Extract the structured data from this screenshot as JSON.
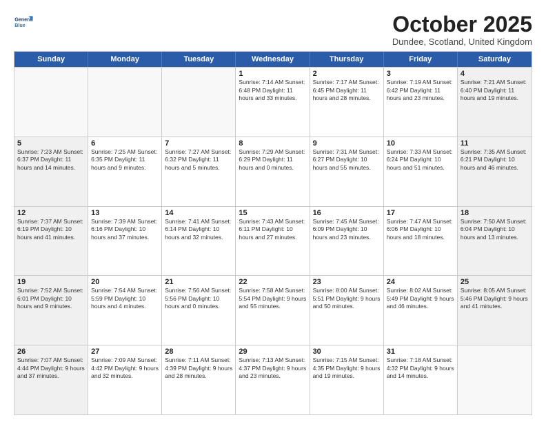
{
  "header": {
    "logo_line1": "General",
    "logo_line2": "Blue",
    "month": "October 2025",
    "location": "Dundee, Scotland, United Kingdom"
  },
  "weekdays": [
    "Sunday",
    "Monday",
    "Tuesday",
    "Wednesday",
    "Thursday",
    "Friday",
    "Saturday"
  ],
  "rows": [
    [
      {
        "day": "",
        "text": "",
        "empty": true
      },
      {
        "day": "",
        "text": "",
        "empty": true
      },
      {
        "day": "",
        "text": "",
        "empty": true
      },
      {
        "day": "1",
        "text": "Sunrise: 7:14 AM\nSunset: 6:48 PM\nDaylight: 11 hours\nand 33 minutes."
      },
      {
        "day": "2",
        "text": "Sunrise: 7:17 AM\nSunset: 6:45 PM\nDaylight: 11 hours\nand 28 minutes."
      },
      {
        "day": "3",
        "text": "Sunrise: 7:19 AM\nSunset: 6:42 PM\nDaylight: 11 hours\nand 23 minutes."
      },
      {
        "day": "4",
        "text": "Sunrise: 7:21 AM\nSunset: 6:40 PM\nDaylight: 11 hours\nand 19 minutes.",
        "shaded": true
      }
    ],
    [
      {
        "day": "5",
        "text": "Sunrise: 7:23 AM\nSunset: 6:37 PM\nDaylight: 11 hours\nand 14 minutes.",
        "shaded": true
      },
      {
        "day": "6",
        "text": "Sunrise: 7:25 AM\nSunset: 6:35 PM\nDaylight: 11 hours\nand 9 minutes."
      },
      {
        "day": "7",
        "text": "Sunrise: 7:27 AM\nSunset: 6:32 PM\nDaylight: 11 hours\nand 5 minutes."
      },
      {
        "day": "8",
        "text": "Sunrise: 7:29 AM\nSunset: 6:29 PM\nDaylight: 11 hours\nand 0 minutes."
      },
      {
        "day": "9",
        "text": "Sunrise: 7:31 AM\nSunset: 6:27 PM\nDaylight: 10 hours\nand 55 minutes."
      },
      {
        "day": "10",
        "text": "Sunrise: 7:33 AM\nSunset: 6:24 PM\nDaylight: 10 hours\nand 51 minutes."
      },
      {
        "day": "11",
        "text": "Sunrise: 7:35 AM\nSunset: 6:21 PM\nDaylight: 10 hours\nand 46 minutes.",
        "shaded": true
      }
    ],
    [
      {
        "day": "12",
        "text": "Sunrise: 7:37 AM\nSunset: 6:19 PM\nDaylight: 10 hours\nand 41 minutes.",
        "shaded": true
      },
      {
        "day": "13",
        "text": "Sunrise: 7:39 AM\nSunset: 6:16 PM\nDaylight: 10 hours\nand 37 minutes."
      },
      {
        "day": "14",
        "text": "Sunrise: 7:41 AM\nSunset: 6:14 PM\nDaylight: 10 hours\nand 32 minutes."
      },
      {
        "day": "15",
        "text": "Sunrise: 7:43 AM\nSunset: 6:11 PM\nDaylight: 10 hours\nand 27 minutes."
      },
      {
        "day": "16",
        "text": "Sunrise: 7:45 AM\nSunset: 6:09 PM\nDaylight: 10 hours\nand 23 minutes."
      },
      {
        "day": "17",
        "text": "Sunrise: 7:47 AM\nSunset: 6:06 PM\nDaylight: 10 hours\nand 18 minutes."
      },
      {
        "day": "18",
        "text": "Sunrise: 7:50 AM\nSunset: 6:04 PM\nDaylight: 10 hours\nand 13 minutes.",
        "shaded": true
      }
    ],
    [
      {
        "day": "19",
        "text": "Sunrise: 7:52 AM\nSunset: 6:01 PM\nDaylight: 10 hours\nand 9 minutes.",
        "shaded": true
      },
      {
        "day": "20",
        "text": "Sunrise: 7:54 AM\nSunset: 5:59 PM\nDaylight: 10 hours\nand 4 minutes."
      },
      {
        "day": "21",
        "text": "Sunrise: 7:56 AM\nSunset: 5:56 PM\nDaylight: 10 hours\nand 0 minutes."
      },
      {
        "day": "22",
        "text": "Sunrise: 7:58 AM\nSunset: 5:54 PM\nDaylight: 9 hours\nand 55 minutes."
      },
      {
        "day": "23",
        "text": "Sunrise: 8:00 AM\nSunset: 5:51 PM\nDaylight: 9 hours\nand 50 minutes."
      },
      {
        "day": "24",
        "text": "Sunrise: 8:02 AM\nSunset: 5:49 PM\nDaylight: 9 hours\nand 46 minutes."
      },
      {
        "day": "25",
        "text": "Sunrise: 8:05 AM\nSunset: 5:46 PM\nDaylight: 9 hours\nand 41 minutes.",
        "shaded": true
      }
    ],
    [
      {
        "day": "26",
        "text": "Sunrise: 7:07 AM\nSunset: 4:44 PM\nDaylight: 9 hours\nand 37 minutes.",
        "shaded": true
      },
      {
        "day": "27",
        "text": "Sunrise: 7:09 AM\nSunset: 4:42 PM\nDaylight: 9 hours\nand 32 minutes."
      },
      {
        "day": "28",
        "text": "Sunrise: 7:11 AM\nSunset: 4:39 PM\nDaylight: 9 hours\nand 28 minutes."
      },
      {
        "day": "29",
        "text": "Sunrise: 7:13 AM\nSunset: 4:37 PM\nDaylight: 9 hours\nand 23 minutes."
      },
      {
        "day": "30",
        "text": "Sunrise: 7:15 AM\nSunset: 4:35 PM\nDaylight: 9 hours\nand 19 minutes."
      },
      {
        "day": "31",
        "text": "Sunrise: 7:18 AM\nSunset: 4:32 PM\nDaylight: 9 hours\nand 14 minutes."
      },
      {
        "day": "",
        "text": "",
        "empty": true
      }
    ]
  ]
}
